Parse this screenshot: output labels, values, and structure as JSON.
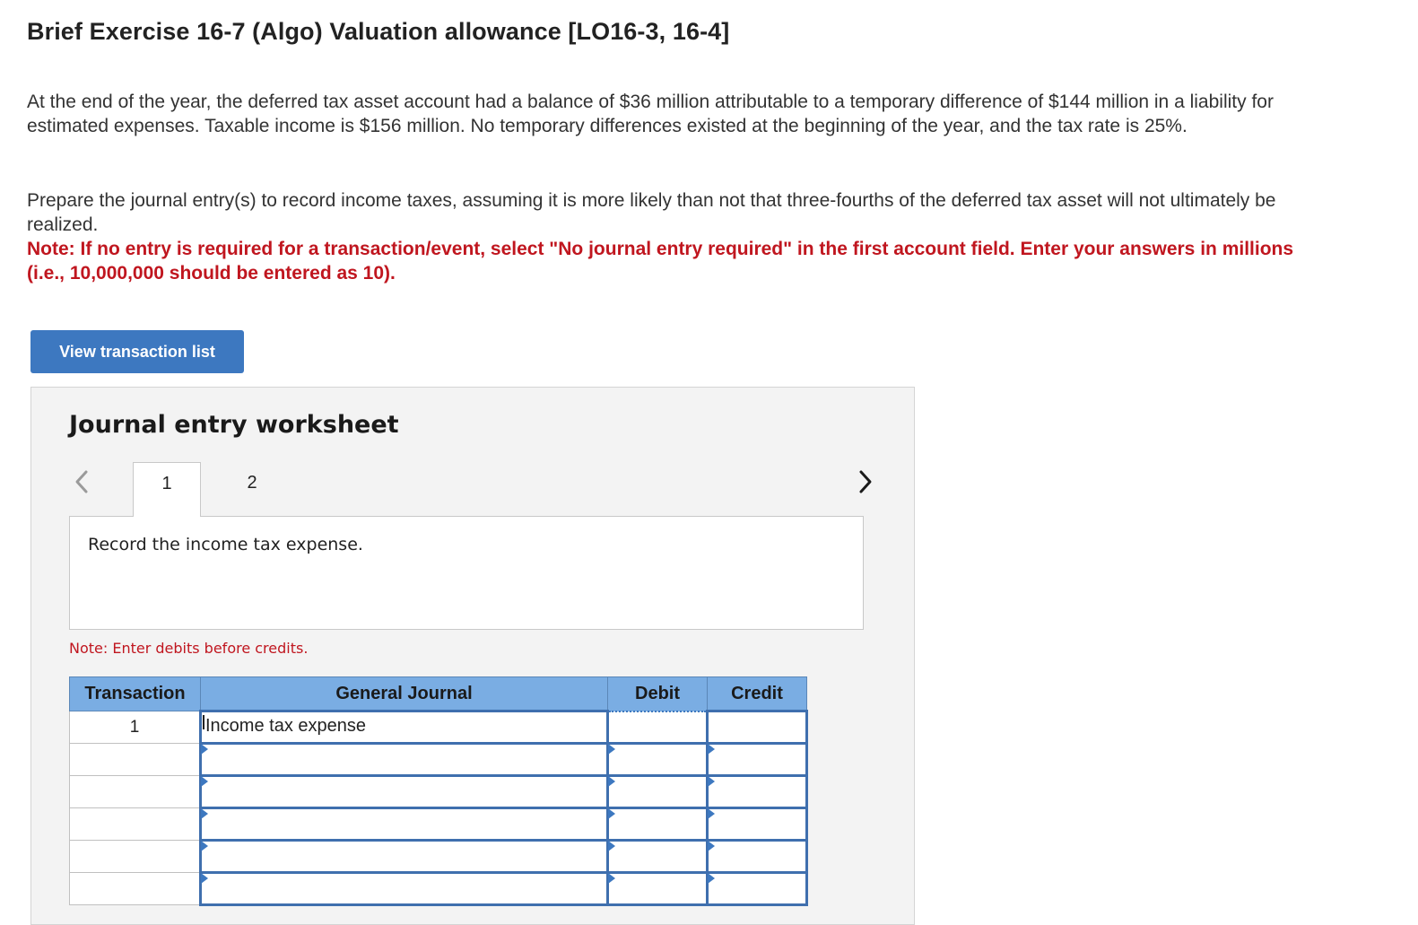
{
  "page": {
    "title": "Brief Exercise 16-7 (Algo) Valuation allowance [LO16-3, 16-4]",
    "problem": "At the end of the year, the deferred tax asset account had a balance of $36 million attributable to a temporary difference of $144 million in a liability for estimated expenses. Taxable income is $156 million. No temporary differences existed at the beginning of the year, and the tax rate is 25%.",
    "instruction": "Prepare the journal entry(s) to record income taxes, assuming it is more likely than not that three-fourths of the deferred tax asset will not ultimately be realized.",
    "note": "Note: If no entry is required for a transaction/event, select \"No journal entry required\" in the first account field. Enter your answers in millions (i.e., 10,000,000 should be entered as 10)."
  },
  "buttons": {
    "view_transaction_list": "View transaction list"
  },
  "worksheet": {
    "title": "Journal entry worksheet",
    "tabs": [
      {
        "label": "1",
        "active": true
      },
      {
        "label": "2",
        "active": false
      }
    ],
    "description": "Record the income tax expense.",
    "debits_note": "Note: Enter debits before credits.",
    "table": {
      "headers": [
        "Transaction",
        "General Journal",
        "Debit",
        "Credit"
      ],
      "rows": [
        {
          "transaction": "1",
          "account": "Income tax expense",
          "debit": "",
          "credit": ""
        },
        {
          "transaction": "",
          "account": "",
          "debit": "",
          "credit": ""
        },
        {
          "transaction": "",
          "account": "",
          "debit": "",
          "credit": ""
        },
        {
          "transaction": "",
          "account": "",
          "debit": "",
          "credit": ""
        },
        {
          "transaction": "",
          "account": "",
          "debit": "",
          "credit": ""
        },
        {
          "transaction": "",
          "account": "",
          "debit": "",
          "credit": ""
        }
      ]
    }
  },
  "icons": {
    "prev": "chevron-left-icon",
    "next": "chevron-right-icon",
    "row_marker": "triangle-right-icon"
  },
  "colors": {
    "note_red": "#c0161f",
    "button_blue": "#3d78c0",
    "header_blue": "#7aade3",
    "input_border": "#3f6fae",
    "worksheet_bg": "#f3f3f3"
  }
}
